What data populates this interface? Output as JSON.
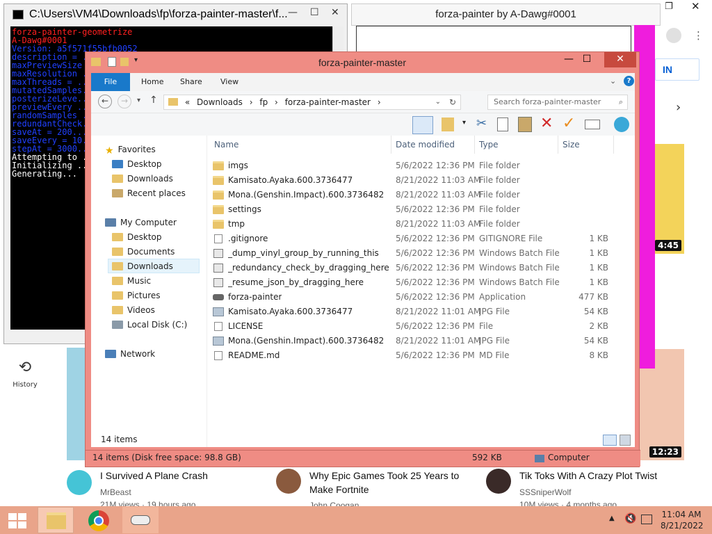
{
  "console": {
    "title": "C:\\Users\\VM4\\Downloads\\fp\\forza-painter-master\\f...",
    "lines": [
      {
        "t": "forza-painter-geometrize",
        "c": "#ff2020"
      },
      {
        "t": "A-Dawg#0001",
        "c": "#ff2020"
      },
      {
        "t": "Version: a5f571f55bfb0052",
        "c": "#2040ff"
      },
      {
        "t": "description = ...",
        "c": "#2040ff"
      },
      {
        "t": "maxPreviewSize ...",
        "c": "#2040ff"
      },
      {
        "t": "maxResolution ...",
        "c": "#2040ff"
      },
      {
        "t": "maxThreads = ...",
        "c": "#2040ff"
      },
      {
        "t": "mutatedSamples...",
        "c": "#2040ff"
      },
      {
        "t": "posterizeLeve...",
        "c": "#2040ff"
      },
      {
        "t": "previewEvery ...",
        "c": "#2040ff"
      },
      {
        "t": "randomSamples ...",
        "c": "#2040ff"
      },
      {
        "t": "redundantCheck...",
        "c": "#2040ff"
      },
      {
        "t": "saveAt = 200...",
        "c": "#2040ff"
      },
      {
        "t": "saveEvery = 10...",
        "c": "#2040ff"
      },
      {
        "t": "stepAt = 3000...",
        "c": "#2040ff"
      },
      {
        "t": "Attempting to ...",
        "c": "#ffffff"
      },
      {
        "t": "Initializing ...",
        "c": "#ffffff"
      },
      {
        "t": "Generating...",
        "c": "#ffffff"
      }
    ]
  },
  "painter": {
    "title": "forza-painter by A-Dawg#0001"
  },
  "explorer": {
    "title": "forza-painter-master",
    "tabs": [
      "File",
      "Home",
      "Share",
      "View"
    ],
    "path": [
      "«",
      "Downloads",
      "›",
      "fp",
      "›",
      "forza-painter-master",
      "›"
    ],
    "search_placeholder": "Search forza-painter-master",
    "nav": {
      "favorites": "Favorites",
      "fav_items": [
        "Desktop",
        "Downloads",
        "Recent places"
      ],
      "computer": "My Computer",
      "comp_items": [
        "Desktop",
        "Documents",
        "Downloads",
        "Music",
        "Pictures",
        "Videos",
        "Local Disk (C:)"
      ],
      "network": "Network"
    },
    "columns": [
      "Name",
      "Date modified",
      "Type",
      "Size"
    ],
    "files": [
      {
        "name": "imgs",
        "date": "5/6/2022 12:36 PM",
        "type": "File folder",
        "size": "",
        "icon": "folder"
      },
      {
        "name": "Kamisato.Ayaka.600.3736477",
        "date": "8/21/2022 11:03 AM",
        "type": "File folder",
        "size": "",
        "icon": "folder"
      },
      {
        "name": "Mona.(Genshin.Impact).600.3736482",
        "date": "8/21/2022 11:03 AM",
        "type": "File folder",
        "size": "",
        "icon": "folder"
      },
      {
        "name": "settings",
        "date": "5/6/2022 12:36 PM",
        "type": "File folder",
        "size": "",
        "icon": "folder"
      },
      {
        "name": "tmp",
        "date": "8/21/2022 11:03 AM",
        "type": "File folder",
        "size": "",
        "icon": "folder"
      },
      {
        "name": ".gitignore",
        "date": "5/6/2022 12:36 PM",
        "type": "GITIGNORE File",
        "size": "1 KB",
        "icon": "doc"
      },
      {
        "name": "_dump_vinyl_group_by_running_this",
        "date": "5/6/2022 12:36 PM",
        "type": "Windows Batch File",
        "size": "1 KB",
        "icon": "bat"
      },
      {
        "name": "_redundancy_check_by_dragging_here",
        "date": "5/6/2022 12:36 PM",
        "type": "Windows Batch File",
        "size": "1 KB",
        "icon": "bat"
      },
      {
        "name": "_resume_json_by_dragging_here",
        "date": "5/6/2022 12:36 PM",
        "type": "Windows Batch File",
        "size": "1 KB",
        "icon": "bat"
      },
      {
        "name": "forza-painter",
        "date": "5/6/2022 12:36 PM",
        "type": "Application",
        "size": "477 KB",
        "icon": "app"
      },
      {
        "name": "Kamisato.Ayaka.600.3736477",
        "date": "8/21/2022 11:01 AM",
        "type": "JPG File",
        "size": "54 KB",
        "icon": "jpg"
      },
      {
        "name": "LICENSE",
        "date": "5/6/2022 12:36 PM",
        "type": "File",
        "size": "2 KB",
        "icon": "doc"
      },
      {
        "name": "Mona.(Genshin.Impact).600.3736482",
        "date": "8/21/2022 11:01 AM",
        "type": "JPG File",
        "size": "54 KB",
        "icon": "jpg"
      },
      {
        "name": "README.md",
        "date": "5/6/2022 12:36 PM",
        "type": "MD File",
        "size": "8 KB",
        "icon": "doc"
      }
    ],
    "item_count": "14 items",
    "status_left": "14 items (Disk free space: 98.8 GB)",
    "status_size": "592 KB",
    "status_location": "Computer"
  },
  "youtube": {
    "signin": "IN",
    "history": "History",
    "videos": [
      {
        "title": "I Survived A Plane Crash",
        "channel": "MrBeast",
        "meta": "21M views · 19 hours ago",
        "duration": ""
      },
      {
        "title": "Why Epic Games Took 25 Years to Make Fortnite",
        "channel": "John Coogan",
        "meta": "",
        "duration": ""
      },
      {
        "title": "Tik Toks With A Crazy Plot Twist",
        "channel": "SSSniperWolf",
        "meta": "10M views · 4 months ago",
        "duration": "12:23"
      }
    ],
    "side_duration": "4:45"
  },
  "taskbar": {
    "time": "11:04 AM",
    "date": "8/21/2022"
  },
  "colors": {
    "explorer_frame": "#ef8c84",
    "ribbon_accent": "#1979ca",
    "taskbar": "#e9a48a",
    "magenta": "#ef1ddd"
  }
}
